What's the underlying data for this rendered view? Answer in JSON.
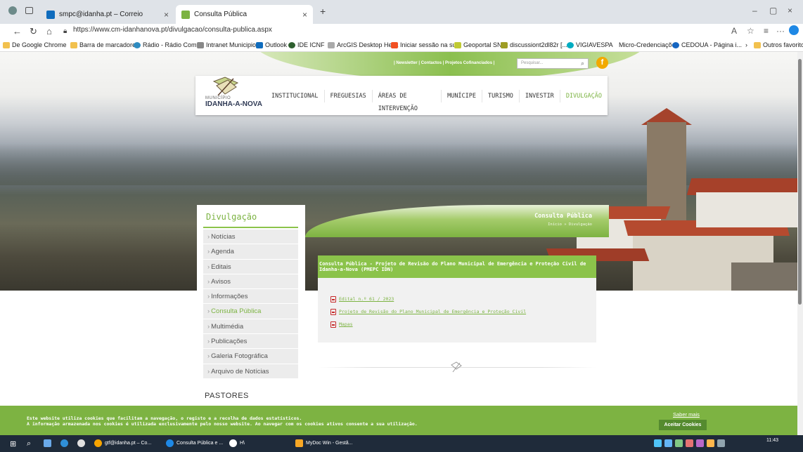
{
  "browser": {
    "tabs": [
      {
        "label": "smpc@idanha.pt – Correio",
        "icon_color": "#0f6cbd"
      },
      {
        "label": "Consulta Pública",
        "icon_color": "#7cb342"
      }
    ],
    "url": "https://www.cm-idanhanova.pt/divulgacao/consulta-publica.aspx",
    "favorites": [
      {
        "label": "De Google Chrome",
        "color": "#f2c14e"
      },
      {
        "label": "Barra de marcadores",
        "color": "#f2c14e"
      },
      {
        "label": "Rádio - Rádio Com...",
        "color": "#2e8bc0"
      },
      {
        "label": "Intranet Municipio...",
        "color": "#888888"
      },
      {
        "label": "Outlook",
        "color": "#0f6cbd"
      },
      {
        "label": "IDE ICNF",
        "color": "#2d5f2e"
      },
      {
        "label": "ArcGIS Desktop Hel...",
        "color": "#aaaaaa"
      },
      {
        "label": "Iniciar sessão na su...",
        "color": "#f25022"
      },
      {
        "label": "Geoportal SNIT",
        "color": "#c0ca33"
      },
      {
        "label": "discussiont2dl82r [...",
        "color": "#9e9d24"
      },
      {
        "label": "VIGIAVESPA",
        "color": "#00acc1"
      },
      {
        "label": "Micro-Credenciações",
        "color": "#ffffff"
      },
      {
        "label": "CEDOUA - Página i...",
        "color": "#1565c0"
      },
      {
        "label": "Outros favoritos",
        "color": "#f2c14e"
      }
    ]
  },
  "site": {
    "logo_sub": "MUNICÍPIO",
    "logo_main": "IDANHA-A-NOVA",
    "toplinks": "| Newsletter | Contactos | Projetos Cofinanciados |",
    "search_placeholder": "Pesquisar...",
    "menu": [
      "INSTITUCIONAL",
      "FREGUESIAS",
      "ÁREAS DE INTERVENÇÃO",
      "MUNÍCIPE",
      "TURISMO",
      "INVESTIR",
      "DIVULGAÇÃO"
    ],
    "sidebar": {
      "title": "Divulgação",
      "items": [
        "Notícias",
        "Agenda",
        "Editais",
        "Avisos",
        "Informações",
        "Consulta Pública",
        "Multimédia",
        "Publicações",
        "Galeria Fotográfica",
        "Arquivo de Notícias"
      ],
      "active": "Consulta Pública",
      "section": "PASTORES"
    },
    "band": {
      "title": "Consulta Pública",
      "crumb": "Início » Divulgação"
    },
    "content": {
      "heading": "Consulta Pública - Projeto de Revisão do Plano Municipal de Emergência e Proteção Civil de Idanha-a-Nova (PMEPC IDN)",
      "documents": [
        "Edital n.º 61 / 2023",
        "Projeto de Revisão do Plano Municipal de Emergência e Proteção Civil",
        "Mapas"
      ]
    },
    "cookie": {
      "line1": "Este website utiliza cookies que facilitam a navegação, o registo e a recolha de dados estatísticos.",
      "line2": "A informação armazenada nos cookies é utilizada exclusivamente pelo nosso website. Ao navegar com os cookies ativos consente a sua utilização.",
      "more": "Saber mais",
      "accept": "Aceitar Cookies"
    }
  },
  "taskbar": {
    "apps": [
      {
        "label": "gtf@idanha.pt – Co...",
        "color": "#f7a400"
      },
      {
        "label": "Consulta Pública e ...",
        "color": "#1e88e5"
      },
      {
        "label": "H\\",
        "color": "#ffffff"
      },
      {
        "label": "MyDoc Win - Gestã...",
        "color": "#f9a825"
      }
    ],
    "time": "11:43"
  }
}
